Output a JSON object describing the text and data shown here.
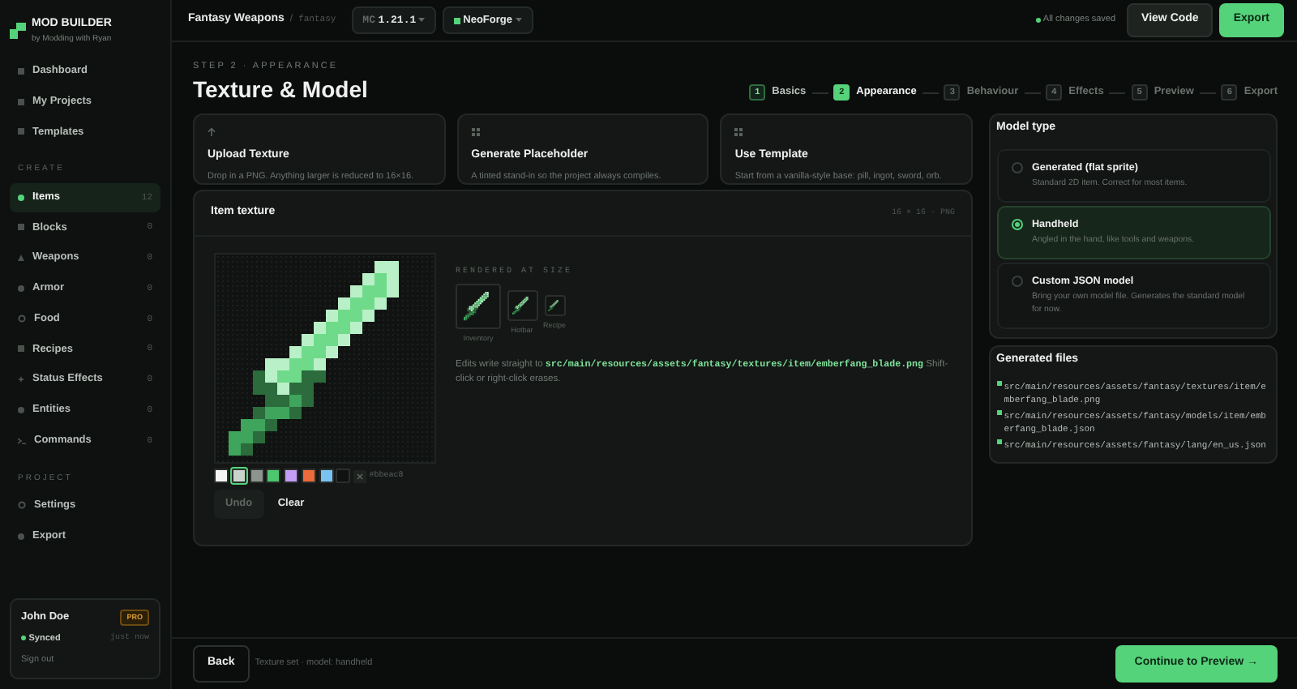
{
  "brand": {
    "title": "MOD BUILDER",
    "subtitle": "by Modding with Ryan"
  },
  "sidebar": {
    "top_items": [
      {
        "label": "Dashboard",
        "kind": "square",
        "selected": false
      },
      {
        "label": "My Projects",
        "kind": "square",
        "selected": false
      },
      {
        "label": "Templates",
        "kind": "square",
        "selected": false
      }
    ],
    "create_heading": "CREATE",
    "create_items": [
      {
        "label": "Items",
        "count": "12",
        "kind": "dot",
        "selected": true
      },
      {
        "label": "Blocks",
        "count": "0",
        "kind": "square",
        "selected": false
      },
      {
        "label": "Weapons",
        "count": "0",
        "kind": "triangle",
        "selected": false
      },
      {
        "label": "Armor",
        "count": "0",
        "kind": "dot",
        "selected": false
      },
      {
        "label": "Food",
        "count": "0",
        "kind": "ring",
        "selected": false
      },
      {
        "label": "Recipes",
        "count": "0",
        "kind": "square",
        "selected": false
      },
      {
        "label": "Status Effects",
        "count": "0",
        "kind": "star",
        "selected": false
      },
      {
        "label": "Entities",
        "count": "0",
        "kind": "dot",
        "selected": false
      },
      {
        "label": "Commands",
        "count": "0",
        "kind": "prompt",
        "selected": false
      }
    ],
    "project_heading": "PROJECT",
    "project_items": [
      {
        "label": "Settings",
        "kind": "ring",
        "selected": false
      },
      {
        "label": "Export",
        "kind": "dot",
        "selected": false
      }
    ],
    "user": {
      "name": "John Doe",
      "badge": "PRO",
      "sync": "Synced",
      "sync_time": "just now",
      "sign_out": "Sign out"
    }
  },
  "topbar": {
    "project": "Fantasy Weapons",
    "separator": "/",
    "namespace": "fantasy",
    "version_prefix": "MC",
    "version": "1.21.1",
    "loader": "NeoForge",
    "save_status": "All changes saved",
    "buttons": [
      "View Code",
      "Export"
    ]
  },
  "page": {
    "step_label": "STEP 2 · APPEARANCE",
    "title": "Texture & Model"
  },
  "steps": [
    {
      "number": "1",
      "label": "Basics",
      "done": true,
      "selected": false
    },
    {
      "number": "2",
      "label": "Appearance",
      "done": false,
      "selected": true
    },
    {
      "number": "3",
      "label": "Behaviour",
      "done": false,
      "selected": false
    },
    {
      "number": "4",
      "label": "Effects",
      "done": false,
      "selected": false
    },
    {
      "number": "5",
      "label": "Preview",
      "done": false,
      "selected": false
    },
    {
      "number": "6",
      "label": "Export",
      "done": false,
      "selected": false
    }
  ],
  "source_cards": [
    {
      "kind": "upload",
      "title": "Upload Texture",
      "text": "Drop in a PNG. Anything larger is reduced to 16×16."
    },
    {
      "kind": "grid",
      "title": "Generate Placeholder",
      "text": "A tinted stand-in so the project always compiles."
    },
    {
      "kind": "grid",
      "title": "Use Template",
      "text": "Start from a vanilla-style base: pill, ingot, sword, orb."
    }
  ],
  "texture": {
    "title": "Item texture",
    "meta": "16 × 16 · PNG",
    "rendered_heading": "RENDERED AT SIZE",
    "previews": [
      {
        "label": "Inventory",
        "kind": "large"
      },
      {
        "label": "Hotbar",
        "kind": "medium"
      },
      {
        "label": "Recipe",
        "kind": "small"
      }
    ],
    "note_before": "Edits write straight to",
    "note_path": "src/main/resources/assets/fantasy/textures/item/emberfang_blade.png",
    "note_after": "Shift-click or right-click erases.",
    "palette": [
      {
        "color": "#f4f4f4",
        "selected": false
      },
      {
        "color": "#c9d4cc",
        "selected": true
      },
      {
        "color": "#8d958f",
        "selected": false
      },
      {
        "color": "#4cc76f",
        "selected": false
      },
      {
        "color": "#c49cf7",
        "selected": false
      },
      {
        "color": "#ec6a3c",
        "selected": false
      },
      {
        "color": "#78c3f2",
        "selected": false
      },
      {
        "color": "#0f1210",
        "selected": false
      }
    ],
    "hex_value": "#bbeac8",
    "buttons": [
      {
        "label": "Undo",
        "disabled": true
      },
      {
        "label": "Clear",
        "disabled": false
      }
    ]
  },
  "model_type": {
    "title": "Model type",
    "options": [
      {
        "label": "Generated (flat sprite)",
        "text": "Standard 2D item. Correct for most items.",
        "selected": false
      },
      {
        "label": "Handheld",
        "text": "Angled in the hand, like tools and weapons.",
        "selected": true
      },
      {
        "label": "Custom JSON model",
        "text": "Bring your own model file. Generates the standard model for now.",
        "selected": false
      }
    ]
  },
  "generated_files": {
    "title": "Generated files",
    "files": [
      "src/main/resources/assets/fantasy/textures/item/emberfang_blade.png",
      "src/main/resources/assets/fantasy/models/item/emberfang_blade.json",
      "src/main/resources/assets/fantasy/lang/en_us.json"
    ]
  },
  "footer": {
    "back": "Back",
    "status": "Texture set · model: handheld",
    "continue": "Continue to Preview →"
  }
}
